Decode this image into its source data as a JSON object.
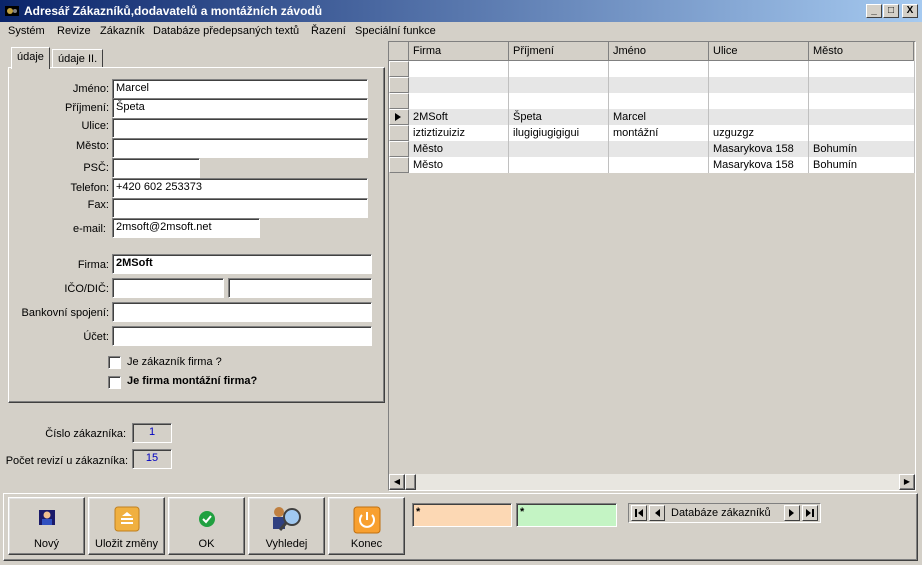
{
  "window": {
    "title": "Adresář Zákazníků,dodavatelů a montážních závodů",
    "min": "_",
    "max": "□",
    "close": "X"
  },
  "menu": [
    "Systém",
    "Revize",
    "Zákazník",
    "Databáze předepsaných textů",
    "Řazení",
    "Speciální funkce"
  ],
  "tabs": [
    "údaje",
    "údaje II."
  ],
  "form": {
    "jmeno_label": "Jméno:",
    "jmeno": "Marcel",
    "prijmeni_label": "Příjmení:",
    "prijmeni": "Špeta",
    "ulice_label": "Ulice:",
    "ulice": "",
    "mesto_label": "Město:",
    "mesto": "",
    "psc_label": "PSČ:",
    "psc": "",
    "telefon_label": "Telefon:",
    "telefon": "+420 602 253373",
    "fax_label": "Fax:",
    "fax": "",
    "email_label": "e-mail:",
    "email": "2msoft@2msoft.net",
    "firma_label": "Firma:",
    "firma": "2MSoft",
    "ico_label": "IČO/DIČ:",
    "ico": "",
    "dic": "",
    "bank_label": "Bankovní spojení:",
    "bank": "",
    "ucet_label": "Účet:",
    "ucet": "",
    "chk1_label": "Je zákazník firma ?",
    "chk2_label": "Je firma montážní firma?"
  },
  "stats": {
    "cislo_label": "Číslo zákazníka:",
    "cislo": "1",
    "revize_label": "Počet revizí u zákazníka:",
    "revize": "15"
  },
  "grid": {
    "columns": [
      "Firma",
      "Příjmení",
      "Jméno",
      "Ulice",
      "Město"
    ],
    "rows": [
      [
        "",
        "",
        "",
        "",
        ""
      ],
      [
        "",
        "",
        "",
        "",
        ""
      ],
      [
        "",
        "",
        "",
        "",
        ""
      ],
      [
        "2MSoft",
        "Špeta",
        "Marcel",
        "",
        ""
      ],
      [
        "iztiztizuiziz",
        "ilugigiugigigui",
        "montážní",
        "uzguzgz",
        ""
      ],
      [
        "Město",
        "",
        "",
        "Masarykova 158",
        "Bohumín"
      ],
      [
        "Město",
        "",
        "",
        "Masarykova 158",
        "Bohumín"
      ]
    ],
    "current_row": 3
  },
  "buttons": [
    "Nový",
    "Uložit změny",
    "OK",
    "Vyhledej",
    "Konec"
  ],
  "filters": {
    "filter1": "*",
    "filter2": "*"
  },
  "nav": {
    "label": "Databáze zákazníků"
  },
  "colors": {
    "filter1": "#fcd8b4",
    "filter2": "#c4f4c4",
    "title_start": "#0a246a",
    "stat_text": "#0000c0"
  }
}
